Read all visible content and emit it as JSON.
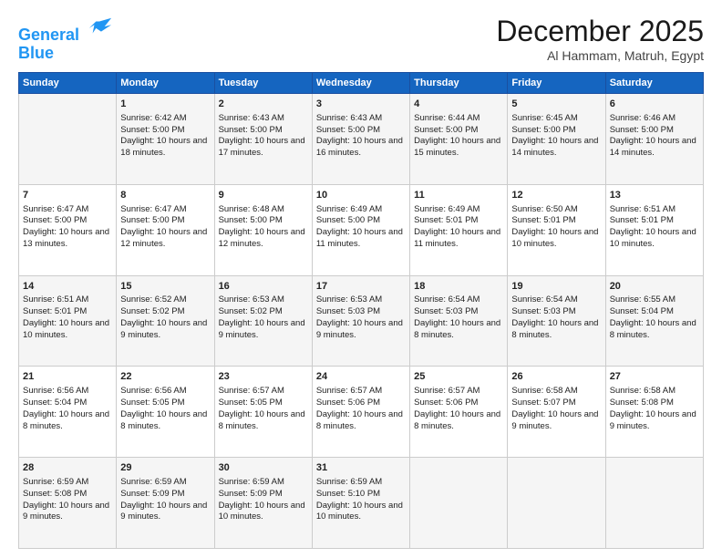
{
  "header": {
    "logo_line1": "General",
    "logo_line2": "Blue",
    "month": "December 2025",
    "location": "Al Hammam, Matruh, Egypt"
  },
  "days_of_week": [
    "Sunday",
    "Monday",
    "Tuesday",
    "Wednesday",
    "Thursday",
    "Friday",
    "Saturday"
  ],
  "weeks": [
    [
      {
        "day": "",
        "sunrise": "",
        "sunset": "",
        "daylight": ""
      },
      {
        "day": "1",
        "sunrise": "Sunrise: 6:42 AM",
        "sunset": "Sunset: 5:00 PM",
        "daylight": "Daylight: 10 hours and 18 minutes."
      },
      {
        "day": "2",
        "sunrise": "Sunrise: 6:43 AM",
        "sunset": "Sunset: 5:00 PM",
        "daylight": "Daylight: 10 hours and 17 minutes."
      },
      {
        "day": "3",
        "sunrise": "Sunrise: 6:43 AM",
        "sunset": "Sunset: 5:00 PM",
        "daylight": "Daylight: 10 hours and 16 minutes."
      },
      {
        "day": "4",
        "sunrise": "Sunrise: 6:44 AM",
        "sunset": "Sunset: 5:00 PM",
        "daylight": "Daylight: 10 hours and 15 minutes."
      },
      {
        "day": "5",
        "sunrise": "Sunrise: 6:45 AM",
        "sunset": "Sunset: 5:00 PM",
        "daylight": "Daylight: 10 hours and 14 minutes."
      },
      {
        "day": "6",
        "sunrise": "Sunrise: 6:46 AM",
        "sunset": "Sunset: 5:00 PM",
        "daylight": "Daylight: 10 hours and 14 minutes."
      }
    ],
    [
      {
        "day": "7",
        "sunrise": "Sunrise: 6:47 AM",
        "sunset": "Sunset: 5:00 PM",
        "daylight": "Daylight: 10 hours and 13 minutes."
      },
      {
        "day": "8",
        "sunrise": "Sunrise: 6:47 AM",
        "sunset": "Sunset: 5:00 PM",
        "daylight": "Daylight: 10 hours and 12 minutes."
      },
      {
        "day": "9",
        "sunrise": "Sunrise: 6:48 AM",
        "sunset": "Sunset: 5:00 PM",
        "daylight": "Daylight: 10 hours and 12 minutes."
      },
      {
        "day": "10",
        "sunrise": "Sunrise: 6:49 AM",
        "sunset": "Sunset: 5:00 PM",
        "daylight": "Daylight: 10 hours and 11 minutes."
      },
      {
        "day": "11",
        "sunrise": "Sunrise: 6:49 AM",
        "sunset": "Sunset: 5:01 PM",
        "daylight": "Daylight: 10 hours and 11 minutes."
      },
      {
        "day": "12",
        "sunrise": "Sunrise: 6:50 AM",
        "sunset": "Sunset: 5:01 PM",
        "daylight": "Daylight: 10 hours and 10 minutes."
      },
      {
        "day": "13",
        "sunrise": "Sunrise: 6:51 AM",
        "sunset": "Sunset: 5:01 PM",
        "daylight": "Daylight: 10 hours and 10 minutes."
      }
    ],
    [
      {
        "day": "14",
        "sunrise": "Sunrise: 6:51 AM",
        "sunset": "Sunset: 5:01 PM",
        "daylight": "Daylight: 10 hours and 10 minutes."
      },
      {
        "day": "15",
        "sunrise": "Sunrise: 6:52 AM",
        "sunset": "Sunset: 5:02 PM",
        "daylight": "Daylight: 10 hours and 9 minutes."
      },
      {
        "day": "16",
        "sunrise": "Sunrise: 6:53 AM",
        "sunset": "Sunset: 5:02 PM",
        "daylight": "Daylight: 10 hours and 9 minutes."
      },
      {
        "day": "17",
        "sunrise": "Sunrise: 6:53 AM",
        "sunset": "Sunset: 5:03 PM",
        "daylight": "Daylight: 10 hours and 9 minutes."
      },
      {
        "day": "18",
        "sunrise": "Sunrise: 6:54 AM",
        "sunset": "Sunset: 5:03 PM",
        "daylight": "Daylight: 10 hours and 8 minutes."
      },
      {
        "day": "19",
        "sunrise": "Sunrise: 6:54 AM",
        "sunset": "Sunset: 5:03 PM",
        "daylight": "Daylight: 10 hours and 8 minutes."
      },
      {
        "day": "20",
        "sunrise": "Sunrise: 6:55 AM",
        "sunset": "Sunset: 5:04 PM",
        "daylight": "Daylight: 10 hours and 8 minutes."
      }
    ],
    [
      {
        "day": "21",
        "sunrise": "Sunrise: 6:56 AM",
        "sunset": "Sunset: 5:04 PM",
        "daylight": "Daylight: 10 hours and 8 minutes."
      },
      {
        "day": "22",
        "sunrise": "Sunrise: 6:56 AM",
        "sunset": "Sunset: 5:05 PM",
        "daylight": "Daylight: 10 hours and 8 minutes."
      },
      {
        "day": "23",
        "sunrise": "Sunrise: 6:57 AM",
        "sunset": "Sunset: 5:05 PM",
        "daylight": "Daylight: 10 hours and 8 minutes."
      },
      {
        "day": "24",
        "sunrise": "Sunrise: 6:57 AM",
        "sunset": "Sunset: 5:06 PM",
        "daylight": "Daylight: 10 hours and 8 minutes."
      },
      {
        "day": "25",
        "sunrise": "Sunrise: 6:57 AM",
        "sunset": "Sunset: 5:06 PM",
        "daylight": "Daylight: 10 hours and 8 minutes."
      },
      {
        "day": "26",
        "sunrise": "Sunrise: 6:58 AM",
        "sunset": "Sunset: 5:07 PM",
        "daylight": "Daylight: 10 hours and 9 minutes."
      },
      {
        "day": "27",
        "sunrise": "Sunrise: 6:58 AM",
        "sunset": "Sunset: 5:08 PM",
        "daylight": "Daylight: 10 hours and 9 minutes."
      }
    ],
    [
      {
        "day": "28",
        "sunrise": "Sunrise: 6:59 AM",
        "sunset": "Sunset: 5:08 PM",
        "daylight": "Daylight: 10 hours and 9 minutes."
      },
      {
        "day": "29",
        "sunrise": "Sunrise: 6:59 AM",
        "sunset": "Sunset: 5:09 PM",
        "daylight": "Daylight: 10 hours and 9 minutes."
      },
      {
        "day": "30",
        "sunrise": "Sunrise: 6:59 AM",
        "sunset": "Sunset: 5:09 PM",
        "daylight": "Daylight: 10 hours and 10 minutes."
      },
      {
        "day": "31",
        "sunrise": "Sunrise: 6:59 AM",
        "sunset": "Sunset: 5:10 PM",
        "daylight": "Daylight: 10 hours and 10 minutes."
      },
      {
        "day": "",
        "sunrise": "",
        "sunset": "",
        "daylight": ""
      },
      {
        "day": "",
        "sunrise": "",
        "sunset": "",
        "daylight": ""
      },
      {
        "day": "",
        "sunrise": "",
        "sunset": "",
        "daylight": ""
      }
    ]
  ]
}
